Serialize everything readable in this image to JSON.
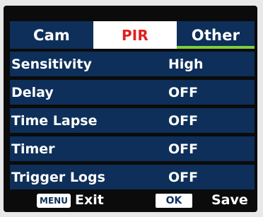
{
  "tabs": [
    {
      "label": "Cam",
      "active": false
    },
    {
      "label": "PIR",
      "active": true
    },
    {
      "label": "Other",
      "active": false
    }
  ],
  "menu": [
    {
      "label": "Sensitivity",
      "value": "High"
    },
    {
      "label": "Delay",
      "value": "OFF"
    },
    {
      "label": "Time Lapse",
      "value": "OFF"
    },
    {
      "label": "Timer",
      "value": "OFF"
    },
    {
      "label": "Trigger Logs",
      "value": "OFF"
    }
  ],
  "footer": {
    "menu_key": "MENU",
    "exit_label": "Exit",
    "ok_key": "OK",
    "save_label": "Save"
  },
  "colors": {
    "row_background": "#0d2f59",
    "active_tab_text": "#e02020",
    "active_tab_background": "#ffffff",
    "other_tab_underline": "#7dcf3a",
    "screen_background": "#0b0b0b"
  }
}
